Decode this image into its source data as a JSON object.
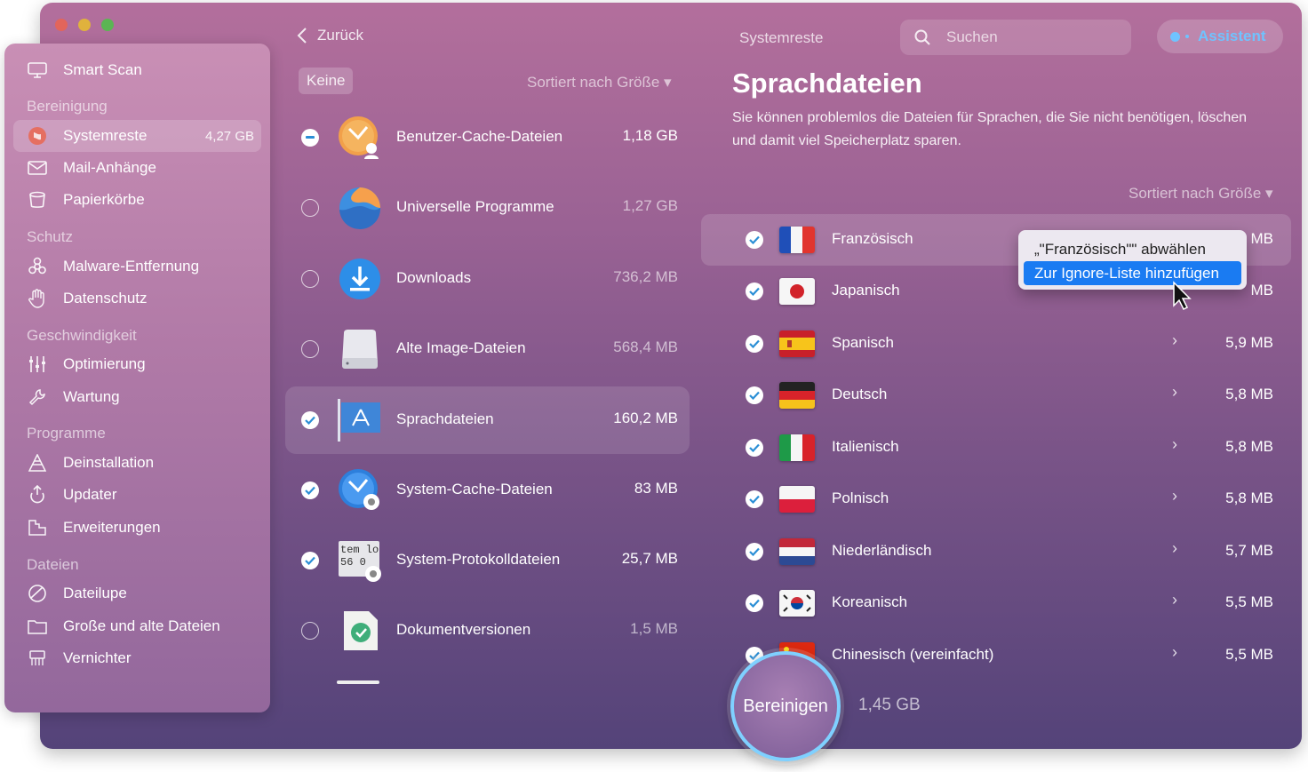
{
  "sidebar": {
    "smart_scan": "Smart Scan",
    "sections": [
      {
        "title": "Bereinigung"
      },
      {
        "title": "Schutz"
      },
      {
        "title": "Geschwindigkeit"
      },
      {
        "title": "Programme"
      },
      {
        "title": "Dateien"
      }
    ],
    "items": {
      "systemreste": {
        "label": "Systemreste",
        "size": "4,27 GB"
      },
      "mail": "Mail-Anhänge",
      "papierkoerbe": "Papierkörbe",
      "malware": "Malware-Entfernung",
      "datenschutz": "Datenschutz",
      "optimierung": "Optimierung",
      "wartung": "Wartung",
      "deinstallation": "Deinstallation",
      "updater": "Updater",
      "erweiterungen": "Erweiterungen",
      "dateilupe": "Dateilupe",
      "grosse": "Große und alte Dateien",
      "vernichter": "Vernichter"
    }
  },
  "middle": {
    "back_label": "Zurück",
    "none_label": "Keine",
    "sort_label": "Sortiert nach Größe ▾",
    "items": [
      {
        "name": "Benutzer-Cache-Dateien",
        "size": "1,18 GB",
        "state": "partial"
      },
      {
        "name": "Universelle Programme",
        "size": "1,27 GB",
        "state": "off"
      },
      {
        "name": "Downloads",
        "size": "736,2 MB",
        "state": "off"
      },
      {
        "name": "Alte Image-Dateien",
        "size": "568,4 MB",
        "state": "off"
      },
      {
        "name": "Sprachdateien",
        "size": "160,2 MB",
        "state": "on"
      },
      {
        "name": "System-Cache-Dateien",
        "size": "83 MB",
        "state": "on"
      },
      {
        "name": "System-Protokolldateien",
        "size": "25,7 MB",
        "state": "on"
      },
      {
        "name": "Dokumentversionen",
        "size": "1,5 MB",
        "state": "off"
      }
    ],
    "log_icon_text": [
      "tem lo",
      "56 0"
    ]
  },
  "right": {
    "top_title": "Systemreste",
    "search_placeholder": "Suchen",
    "assistant_label": "Assistent",
    "heading": "Sprachdateien",
    "description": "Sie können problemlos die Dateien für Sprachen, die Sie nicht benötigen, löschen und damit viel Speicherplatz sparen.",
    "sort_label": "Sortiert nach Größe ▾",
    "languages": [
      {
        "name": "Französisch",
        "size": "MB"
      },
      {
        "name": "Japanisch",
        "size": "MB"
      },
      {
        "name": "Spanisch",
        "size": "5,9 MB"
      },
      {
        "name": "Deutsch",
        "size": "5,8 MB"
      },
      {
        "name": "Italienisch",
        "size": "5,8 MB"
      },
      {
        "name": "Polnisch",
        "size": "5,8 MB"
      },
      {
        "name": "Niederländisch",
        "size": "5,7 MB"
      },
      {
        "name": "Koreanisch",
        "size": "5,5 MB"
      },
      {
        "name": "Chinesisch (vereinfacht)",
        "size": "5,5 MB"
      }
    ],
    "context_menu": {
      "deselect": "„\"Französisch\"\" abwählen",
      "ignore": "Zur Ignore-Liste hinzufügen"
    },
    "clean_button": "Bereinigen",
    "clean_size": "1,45 GB"
  },
  "colors": {
    "accent": "#6fc3ff",
    "menu_highlight": "#1a7bf2",
    "check": "#2b8fd6"
  }
}
